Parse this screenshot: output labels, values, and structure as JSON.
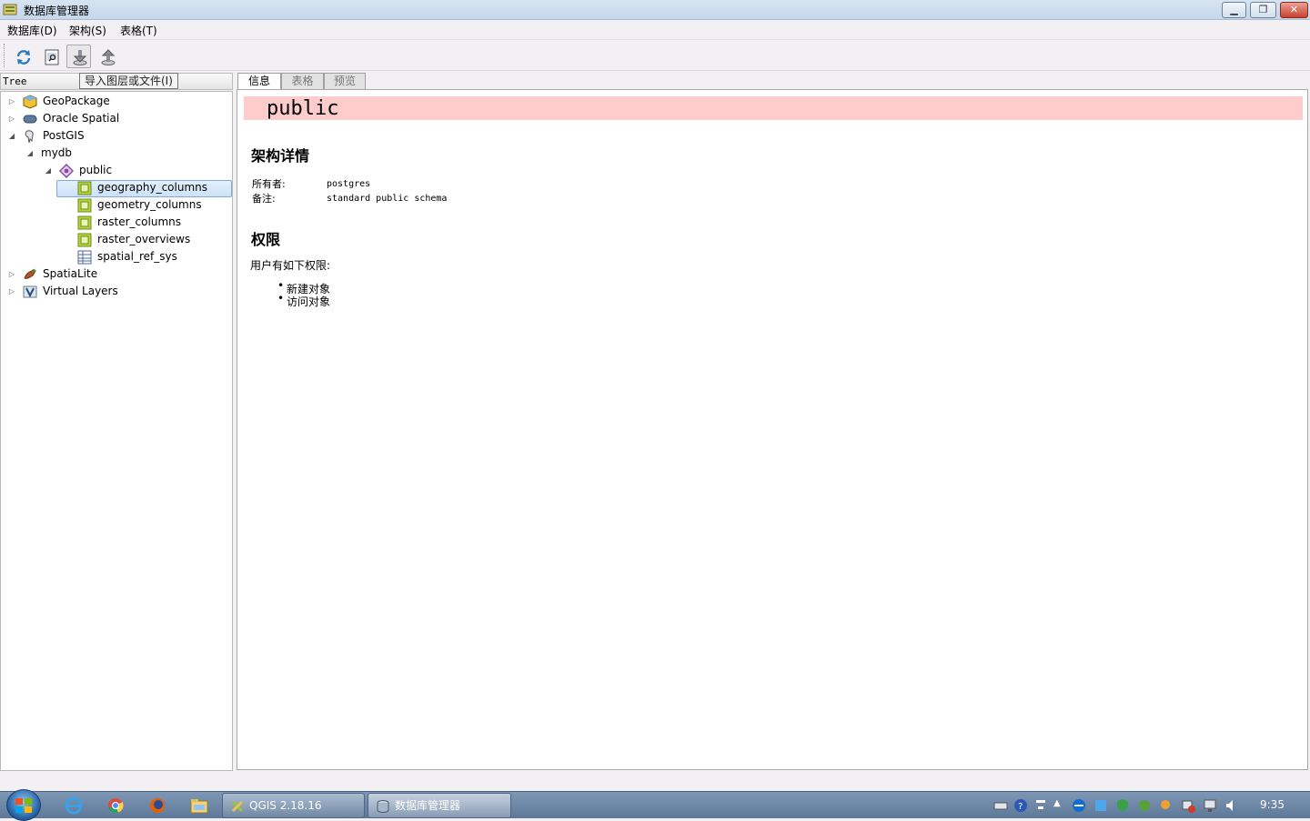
{
  "window": {
    "title": "数据库管理器"
  },
  "menu": [
    "数据库(D)",
    "架构(S)",
    "表格(T)"
  ],
  "toolbar": {
    "buttons": [
      "refresh-icon",
      "sql-window-icon",
      "import-layer-icon",
      "export-icon"
    ],
    "tooltip": "导入图层或文件(I)"
  },
  "tree": {
    "header": "Tree",
    "providers": [
      {
        "label": "GeoPackage",
        "icon": "geopackage-icon"
      },
      {
        "label": "Oracle Spatial",
        "icon": "oracle-icon"
      },
      {
        "label": "PostGIS",
        "icon": "postgis-icon"
      },
      {
        "label": "mydb"
      },
      {
        "label": "public",
        "icon": "schema-icon"
      },
      {
        "label": "geography_columns",
        "icon": "table-icon"
      },
      {
        "label": "geometry_columns",
        "icon": "table-icon"
      },
      {
        "label": "raster_columns",
        "icon": "table-icon"
      },
      {
        "label": "raster_overviews",
        "icon": "table-icon"
      },
      {
        "label": "spatial_ref_sys",
        "icon": "table-icon"
      },
      {
        "label": "SpatiaLite",
        "icon": "spatialite-icon"
      },
      {
        "label": "Virtual Layers",
        "icon": "virtual-layers-icon"
      }
    ]
  },
  "tabs": [
    "信息",
    "表格",
    "预览"
  ],
  "info": {
    "schema_name": "public",
    "details_heading": "架构详情",
    "owner_label": "所有者:",
    "owner_value": "postgres",
    "comment_label": "备注:",
    "comment_value": "standard public schema",
    "privileges_heading": "权限",
    "privileges_intro": "用户有如下权限:",
    "privileges": [
      "新建对象",
      "访问对象"
    ]
  },
  "taskbar": {
    "tasks": [
      "QGIS 2.18.16",
      "数据库管理器"
    ],
    "clock": "9:35"
  }
}
